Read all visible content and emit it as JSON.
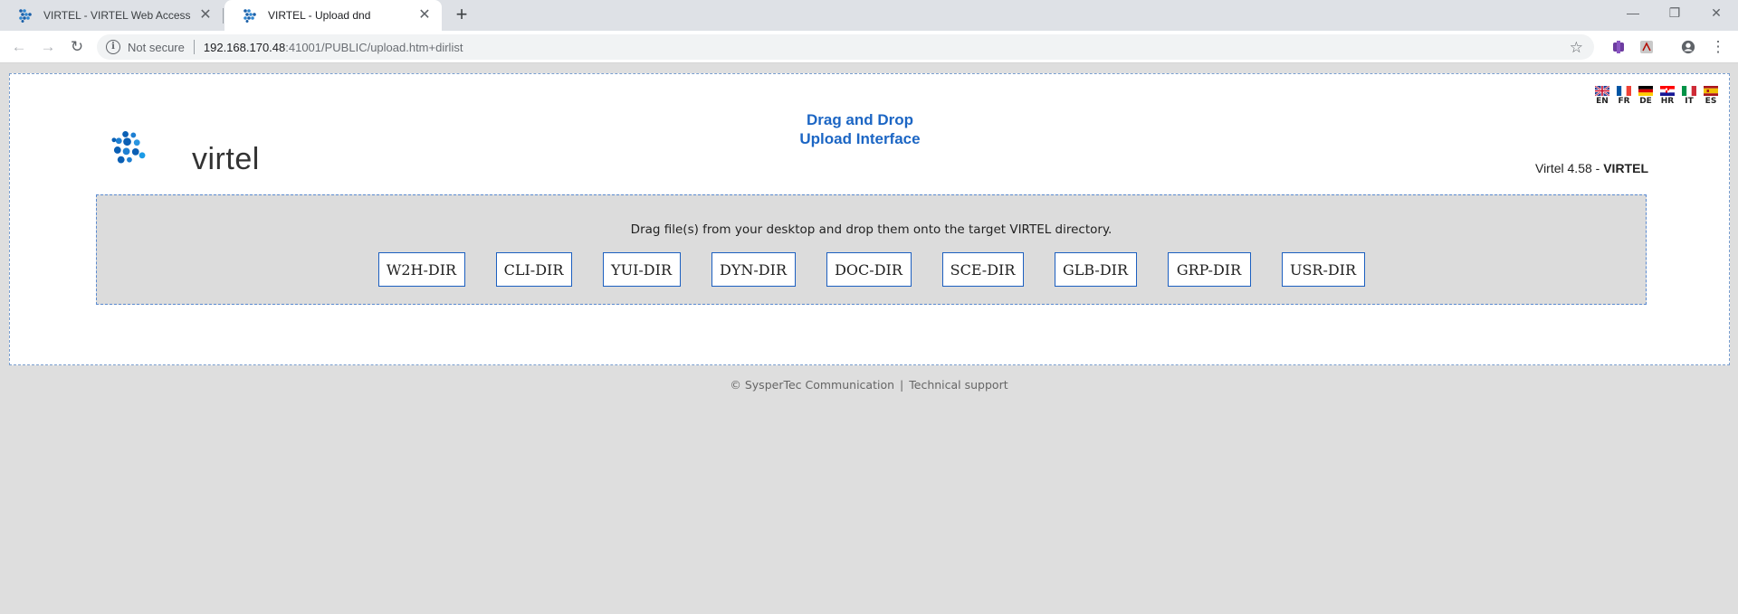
{
  "browser": {
    "tabs": [
      {
        "title": "VIRTEL - VIRTEL Web Access",
        "close": "✕"
      },
      {
        "title": "VIRTEL - Upload dnd",
        "close": "✕"
      }
    ],
    "new_tab": "+",
    "window_controls": {
      "minimize": "—",
      "restore": "❐",
      "close": "✕"
    },
    "nav": {
      "back": "←",
      "forward": "→",
      "reload": "↻"
    },
    "address": {
      "security_text": "Not secure",
      "host": "192.168.170.48",
      "rest": ":41001/PUBLIC/upload.htm+dirlist"
    }
  },
  "page": {
    "logo_text": "virtel",
    "title_line1": "Drag and Drop",
    "title_line2": "Upload Interface",
    "languages": [
      "EN",
      "FR",
      "DE",
      "HR",
      "IT",
      "ES"
    ],
    "version_prefix": "Virtel 4.58 - ",
    "version_product": "VIRTEL",
    "instruction": "Drag file(s) from your desktop and drop them onto the target VIRTEL directory.",
    "directories": [
      "W2H-DIR",
      "CLI-DIR",
      "YUI-DIR",
      "DYN-DIR",
      "DOC-DIR",
      "SCE-DIR",
      "GLB-DIR",
      "GRP-DIR",
      "USR-DIR"
    ]
  },
  "footer": {
    "copyright": "© SysperTec Communication",
    "separator": "|",
    "support": "Technical support"
  }
}
